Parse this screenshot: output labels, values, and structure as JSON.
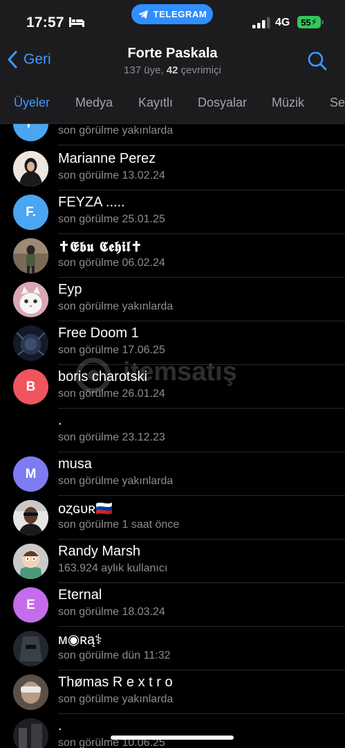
{
  "status_bar": {
    "time": "17:57",
    "pill_label": "TELEGRAM",
    "network": "4G",
    "battery": "55"
  },
  "header": {
    "back_label": "Geri",
    "title": "Forte Paskala",
    "members_count": "137 üye,",
    "online_count": "42",
    "online_label": "çevrimiçi"
  },
  "tabs": [
    "Üyeler",
    "Medya",
    "Kayıtlı",
    "Dosyalar",
    "Müzik",
    "Se"
  ],
  "members": [
    {
      "name": "",
      "status": "son görülme yakınlarda",
      "avatar_letter": "F",
      "avatar_color": "#4aa6f0"
    },
    {
      "name": "Marianne Perez",
      "status": "son görülme 13.02.24",
      "avatar_letter": "",
      "avatar_color": "#e8e2dc"
    },
    {
      "name": "FEYZA .....",
      "status": "son görülme 25.01.25",
      "avatar_letter": "F.",
      "avatar_color": "#4aa6f0"
    },
    {
      "name": "✝𝕰𝖇𝖚 𝕮𝖊𝖍𝖎𝖑✝",
      "status": "son görülme 06.02.24",
      "avatar_letter": "",
      "avatar_color": "#6b5a46"
    },
    {
      "name": "Eyp",
      "status": "son görülme yakınlarda",
      "avatar_letter": "",
      "avatar_color": "#d9a7b3"
    },
    {
      "name": "Free Doom 1",
      "status": "son görülme 17.06.25",
      "avatar_letter": "",
      "avatar_color": "#1d2536"
    },
    {
      "name": "boris charotski",
      "status": "son görülme 26.01.24",
      "avatar_letter": "B",
      "avatar_color": "#f0555d"
    },
    {
      "name": ".",
      "status": "son görülme 23.12.23",
      "avatar_letter": "",
      "avatar_color": ""
    },
    {
      "name": "musa",
      "status": "son görülme yakınlarda",
      "avatar_letter": "M",
      "avatar_color": "#7d7cf2"
    },
    {
      "name": "ᴏȥɢᴜʀ🇷🇺",
      "status": "son görülme 1 saat önce",
      "avatar_letter": "",
      "avatar_color": "#4a4a4a"
    },
    {
      "name": "Randy Marsh",
      "status": "163.924 aylık kullanıcı",
      "avatar_letter": "",
      "avatar_color": "#bfbfbf"
    },
    {
      "name": "Eternal",
      "status": "son görülme 18.03.24",
      "avatar_letter": "E",
      "avatar_color": "#c56cec"
    },
    {
      "name": "ᴍ◉ʀą⚕",
      "status": "son görülme dün 11:32",
      "avatar_letter": "",
      "avatar_color": "#2a2e35"
    },
    {
      "name": "Thømas R e x t r o",
      "status": "son görülme yakınlarda",
      "avatar_letter": "",
      "avatar_color": "#6d6158"
    },
    {
      "name": ".",
      "status": "son görülme 10.06.25",
      "avatar_letter": "",
      "avatar_color": "#3a3a3a"
    }
  ],
  "watermark": "itemsatış",
  "colors": {
    "accent": "#3e9bff",
    "bar": "#1c1c1e",
    "battery": "#34c759",
    "pill": "#2f8fff"
  }
}
